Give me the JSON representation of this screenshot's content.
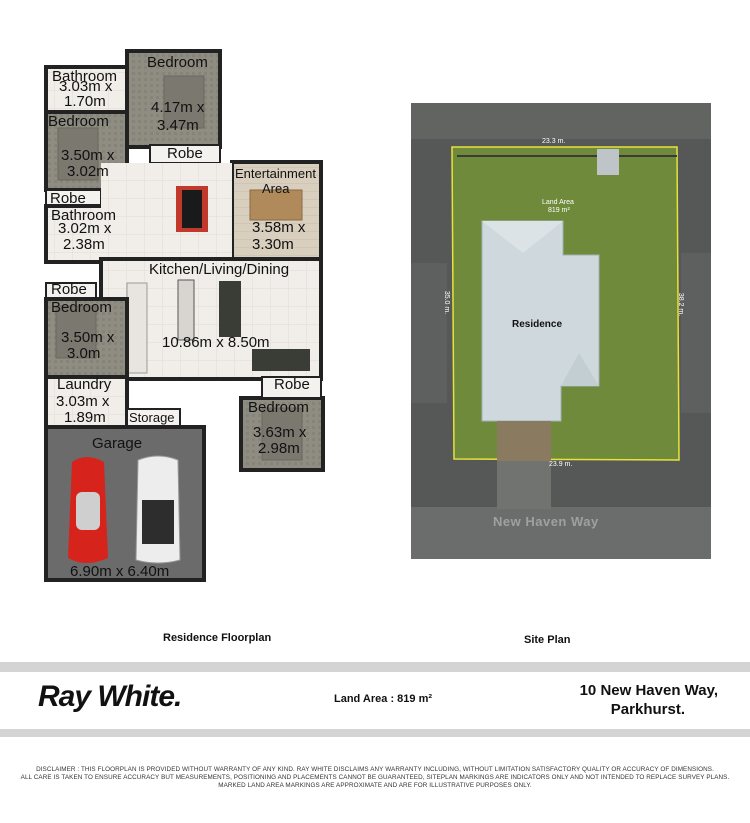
{
  "floorplan": {
    "rooms": [
      {
        "key": "bedroom_top",
        "name": "Bedroom",
        "dims": [
          "4.17m x",
          "3.47m"
        ]
      },
      {
        "key": "bathroom_top",
        "name": "Bathroom",
        "dims": [
          "3.03m x",
          "1.70m"
        ]
      },
      {
        "key": "bedroom_left",
        "name": "Bedroom",
        "dims": [
          "3.50m x",
          "3.02m"
        ]
      },
      {
        "key": "robe_1",
        "name": "Robe"
      },
      {
        "key": "entertainment",
        "name": "Entertainment",
        "name2": "Area",
        "dims": [
          "3.58m x",
          "3.30m"
        ]
      },
      {
        "key": "robe_2",
        "name": "Robe"
      },
      {
        "key": "bathroom_2",
        "name": "Bathroom",
        "dims": [
          "3.02m x",
          "2.38m"
        ]
      },
      {
        "key": "kitchen",
        "name": "Kitchen/Living/Dining",
        "dims": [
          "10.86m x 8.50m"
        ]
      },
      {
        "key": "robe_3",
        "name": "Robe"
      },
      {
        "key": "bedroom_mid",
        "name": "Bedroom",
        "dims": [
          "3.50m x",
          "3.0m"
        ]
      },
      {
        "key": "robe_4",
        "name": "Robe"
      },
      {
        "key": "laundry",
        "name": "Laundry",
        "dims": [
          "3.03m x",
          "1.89m"
        ]
      },
      {
        "key": "storage",
        "name": "Storage"
      },
      {
        "key": "bedroom_br",
        "name": "Bedroom",
        "dims": [
          "3.63m x",
          "2.98m"
        ]
      },
      {
        "key": "garage",
        "name": "Garage",
        "dims": [
          "6.90m x 6.40m"
        ]
      }
    ],
    "caption": "Residence Floorplan"
  },
  "siteplan": {
    "top_dim": "23.3 m.",
    "bottom_dim": "23.9 m.",
    "left_dim": "35.0 m.",
    "right_dim": "38.2 m.",
    "land_area_label": "Land Area",
    "land_area_value": "819 m²",
    "residence_label": "Residence",
    "street": "New Haven Way",
    "caption": "Site Plan"
  },
  "footer": {
    "logo": "Ray White.",
    "land_area": "Land Area : 819 m²",
    "address_line1": "10 New Haven Way,",
    "address_line2": "Parkhurst.",
    "disclaimer_line1": "DISCLAIMER : THIS FLOORPLAN IS PROVIDED WITHOUT WARRANTY OF ANY KIND. RAY WHITE DISCLAIMS ANY WARRANTY INCLUDING, WITHOUT LIMITATION SATISFACTORY QUALITY OR ACCURACY OF DIMENSIONS.",
    "disclaimer_line2": "ALL CARE IS TAKEN TO ENSURE ACCURACY BUT MEASUREMENTS, POSITIONING AND PLACEMENTS CANNOT BE GUARANTEED, SITEPLAN MARKINGS ARE INDICATORS ONLY AND NOT INTENDED TO REPLACE SURVEY PLANS.",
    "disclaimer_line3": "MARKED LAND AREA MARKINGS ARE APPROXIMATE AND ARE FOR ILLUSTRATIVE PURPOSES ONLY."
  },
  "colors": {
    "wall": "#222222",
    "floor_tile": "#f0ede8",
    "carpet": "#8d8a7f",
    "garage_floor": "#6a6a6a",
    "grass": "#6f8a3a",
    "roof": "#cfd8dc",
    "boundary": "#e8e23a",
    "band": "#d9d9d9"
  }
}
